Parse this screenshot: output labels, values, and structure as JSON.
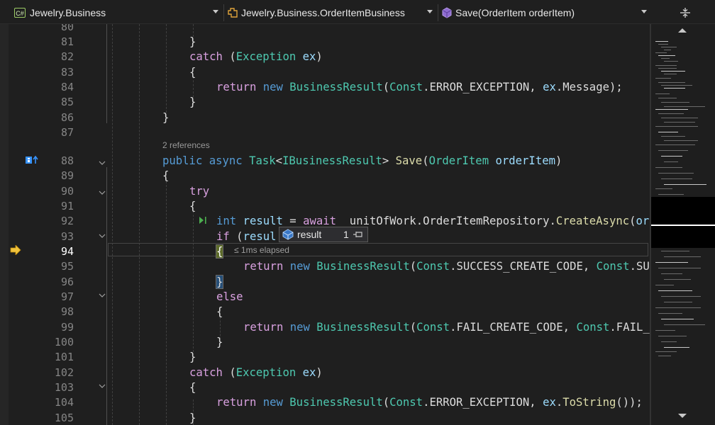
{
  "navbar": {
    "project": "Jewelry.Business",
    "project_icon_text": "C#",
    "class": "Jewelry.Business.OrderItemBusiness",
    "member": "Save(OrderItem orderItem)"
  },
  "editor": {
    "codelens": "2 references",
    "lines": [
      {
        "n": "80"
      },
      {
        "n": "81"
      },
      {
        "n": "82"
      },
      {
        "n": "83"
      },
      {
        "n": "84"
      },
      {
        "n": "85"
      },
      {
        "n": "86"
      },
      {
        "n": "87"
      },
      {
        "n": "88"
      },
      {
        "n": "89"
      },
      {
        "n": "90"
      },
      {
        "n": "91"
      },
      {
        "n": "92"
      },
      {
        "n": "93"
      },
      {
        "n": "94"
      },
      {
        "n": "95"
      },
      {
        "n": "96"
      },
      {
        "n": "97"
      },
      {
        "n": "98"
      },
      {
        "n": "99"
      },
      {
        "n": "100"
      },
      {
        "n": "101"
      },
      {
        "n": "102"
      },
      {
        "n": "103"
      },
      {
        "n": "104"
      },
      {
        "n": "105"
      }
    ],
    "current_line": "94",
    "elapsed": "≤ 1ms elapsed"
  },
  "datatip": {
    "name": "result",
    "value": "1"
  },
  "colors": {
    "keyword": "#569cd6",
    "control": "#d8a0df",
    "type": "#4ec9b0",
    "method": "#dcdcaa",
    "variable": "#9cdcfe",
    "text": "#dcdcdc"
  }
}
